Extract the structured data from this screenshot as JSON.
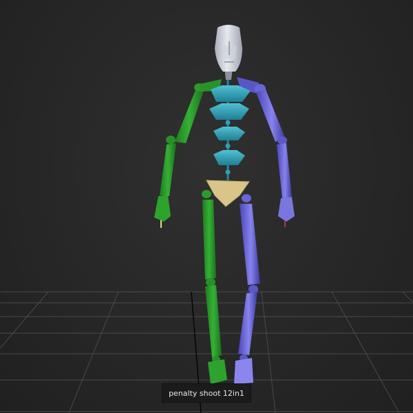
{
  "viewport": {
    "caption": "penalty shoot 12in1",
    "background_color": "#2a2a2a",
    "grid_color": "#4a4a4a"
  },
  "character": {
    "head_color": "#c7ccd6",
    "spine_color": "#2fa0b6",
    "pelvis_color": "#d9c58a",
    "left_side_color": "#2c9a2c",
    "right_side_color": "#6a66d8"
  }
}
